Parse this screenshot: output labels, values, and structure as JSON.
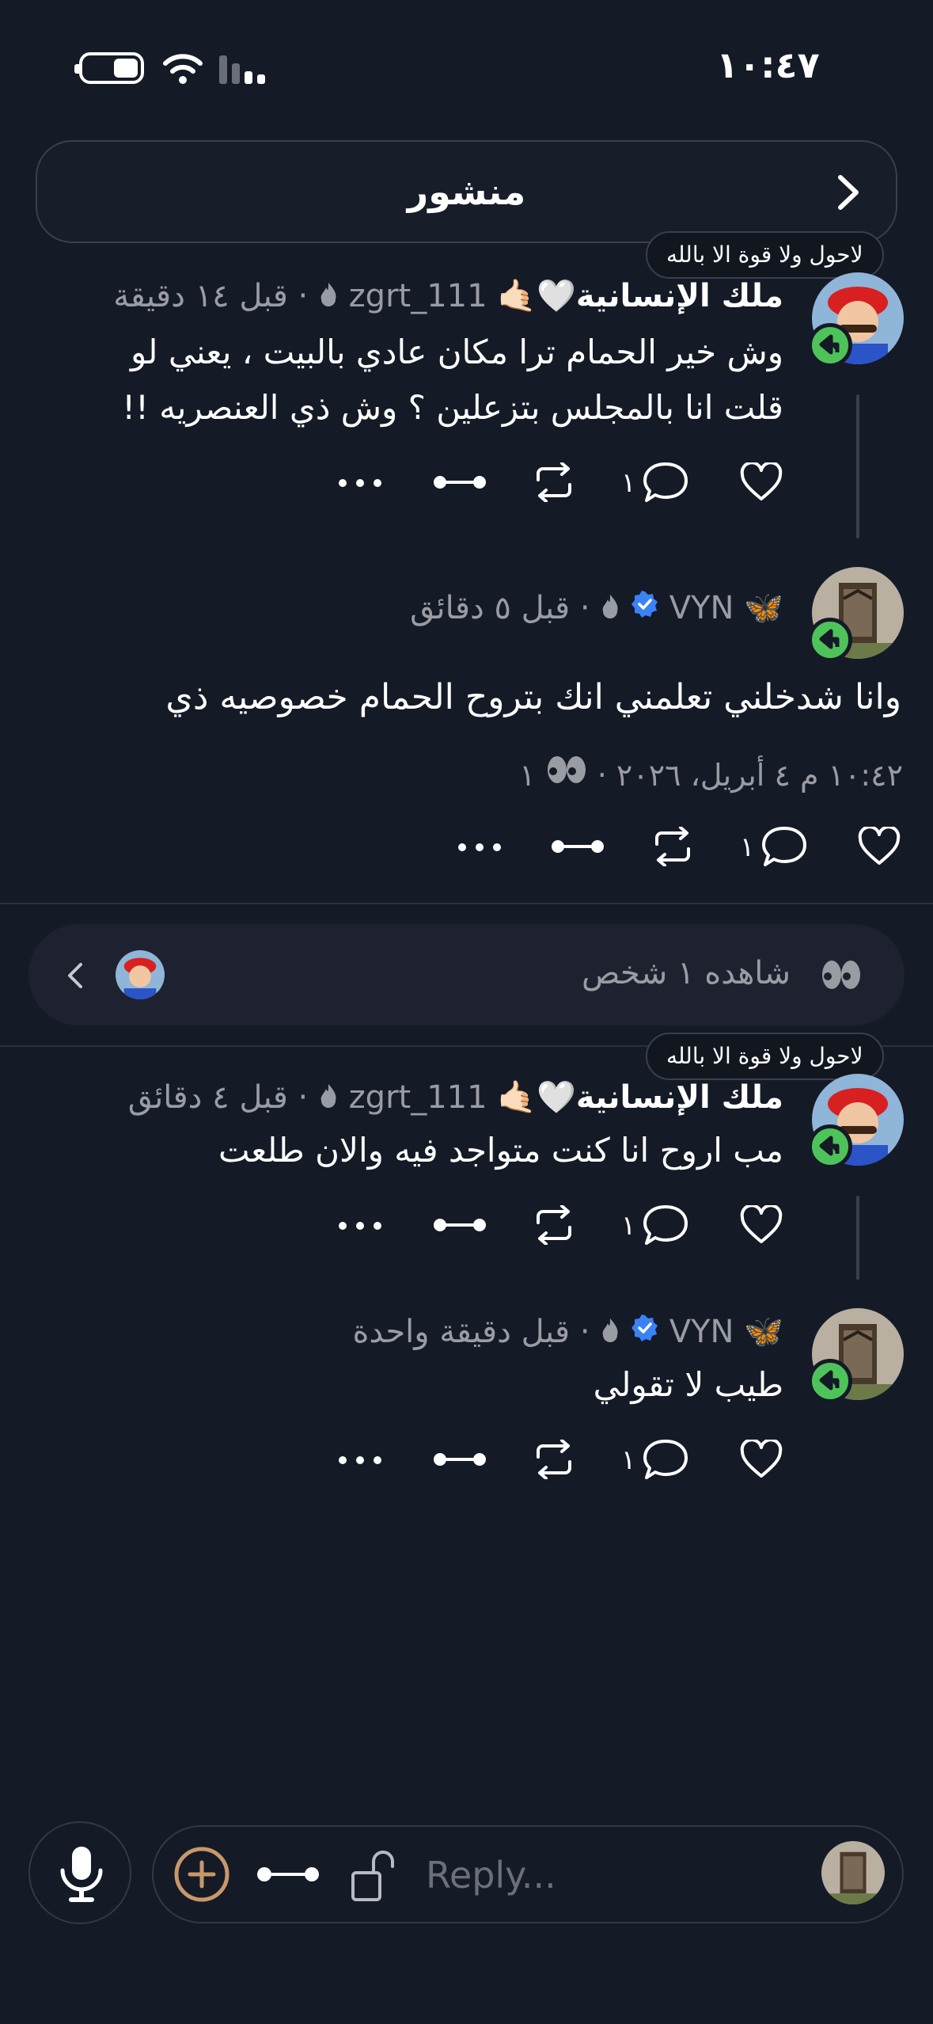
{
  "status": {
    "time": "١٠:٤٧"
  },
  "header": {
    "title": "منشور"
  },
  "badge_text": "لاحول ولا قوة الا بالله",
  "posts": [
    {
      "display_name": "ملك الإنسانية🤍🤙🏻",
      "username": "zgrt_111",
      "time": "قبل ١٤ دقيقة",
      "text_line1": "وش خير الحمام ترا مكان عادي بالبيت ، يعني لو",
      "text_line2": "قلت انا بالمجلس بتزعلين ؟ وش ذي العنصريه !!",
      "reply_count": "١"
    },
    {
      "display_name": "🦋",
      "username": "VYN",
      "time": "قبل ٥ دقائق",
      "text": "وانا شدخلني تعلمني انك بتروح الحمام خصوصيه ذي",
      "timestamp": "١٠:٤٢ م ٤ أبريل، ٢٠٢٦",
      "views": "١",
      "reply_count": "١"
    },
    {
      "display_name": "ملك الإنسانية🤍🤙🏻",
      "username": "zgrt_111",
      "time": "قبل ٤ دقائق",
      "text": "مب اروح انا كنت متواجد فيه والان طلعت",
      "reply_count": "١"
    },
    {
      "display_name": "🦋",
      "username": "VYN",
      "time": "قبل دقيقة واحدة",
      "text": "طيب لا تقولي",
      "reply_count": "١"
    }
  ],
  "viewers": {
    "label": "شاهده ١ شخص"
  },
  "composer": {
    "placeholder": "Reply..."
  },
  "colors": {
    "background": "#151a27",
    "reply_indicator": "#4ec35a",
    "verified": "#3b82f6",
    "add_button": "#c8986a"
  },
  "icons": [
    "chevron-right-icon",
    "like-icon",
    "comment-icon",
    "repost-icon",
    "link-icon",
    "more-icon",
    "eyes-icon",
    "chevron-left-icon",
    "mic-icon",
    "add-icon",
    "lock-open-icon",
    "fire-icon",
    "verified-icon",
    "wifi-icon",
    "signal-icon",
    "battery-icon"
  ]
}
